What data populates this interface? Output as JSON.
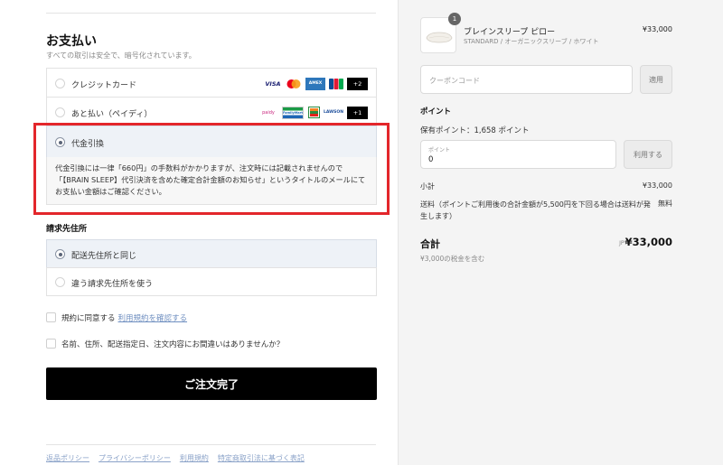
{
  "payment": {
    "title": "お支払い",
    "subtitle": "すべての取引は安全で、暗号化されています。",
    "options": [
      {
        "label": "クレジットカード",
        "selected": false
      },
      {
        "label": "あと払い（ペイディ）",
        "selected": false
      },
      {
        "label": "代金引換",
        "selected": true
      }
    ],
    "card_logos": [
      "VISA",
      "Mastercard",
      "AMEX",
      "JCB"
    ],
    "card_more": "+2",
    "paidy_logos": [
      "paidy",
      "FamilyMart",
      "7-Eleven",
      "LAWSON"
    ],
    "paidy_more": "+1",
    "cod_description": "代金引換には一律「660円」の手数料がかかりますが、注文時には記載されませんので「【BRAIN SLEEP】代引決済を含めた確定合計金額のお知らせ」というタイトルのメールにてお支払い金額はご確認ください。"
  },
  "billing": {
    "title": "請求先住所",
    "options": [
      {
        "label": "配送先住所と同じ",
        "selected": true
      },
      {
        "label": "違う請求先住所を使う",
        "selected": false
      }
    ]
  },
  "agreements": {
    "terms_label": "規約に同意する",
    "terms_link": "利用規約を確認する",
    "confirm_label": "名前、住所、配送指定日、注文内容にお間違いはありませんか？"
  },
  "submit_label": "ご注文完了",
  "footer_links": [
    "返品ポリシー",
    "プライバシーポリシー",
    "利用規約",
    "特定商取引法に基づく表記"
  ],
  "summary": {
    "product": {
      "quantity": "1",
      "name": "ブレインスリープ ピロー",
      "variant": "STANDARD / オーガニックスリーブ / ホワイト",
      "price": "¥33,000"
    },
    "coupon_placeholder": "クーポンコード",
    "apply_label": "適用",
    "points_title": "ポイント",
    "owned_points": "保有ポイント：1,658 ポイント",
    "points_caption": "ポイント",
    "points_value": "0",
    "use_label": "利用する",
    "subtotal_label": "小計",
    "subtotal_value": "¥33,000",
    "shipping_label": "送料（ポイントご利用後の合計金額が5,500円を下回る場合は送料が発生します）",
    "shipping_value": "無料",
    "total_label": "合計",
    "currency": "JPY",
    "total_value": "¥33,000",
    "tax_note": "¥3,000の税金を含む"
  },
  "colors": {
    "highlight_border": "#e3262b",
    "selected_bg": "#eef2f7",
    "submit_bg": "#000000",
    "link": "#6f8fc0"
  }
}
